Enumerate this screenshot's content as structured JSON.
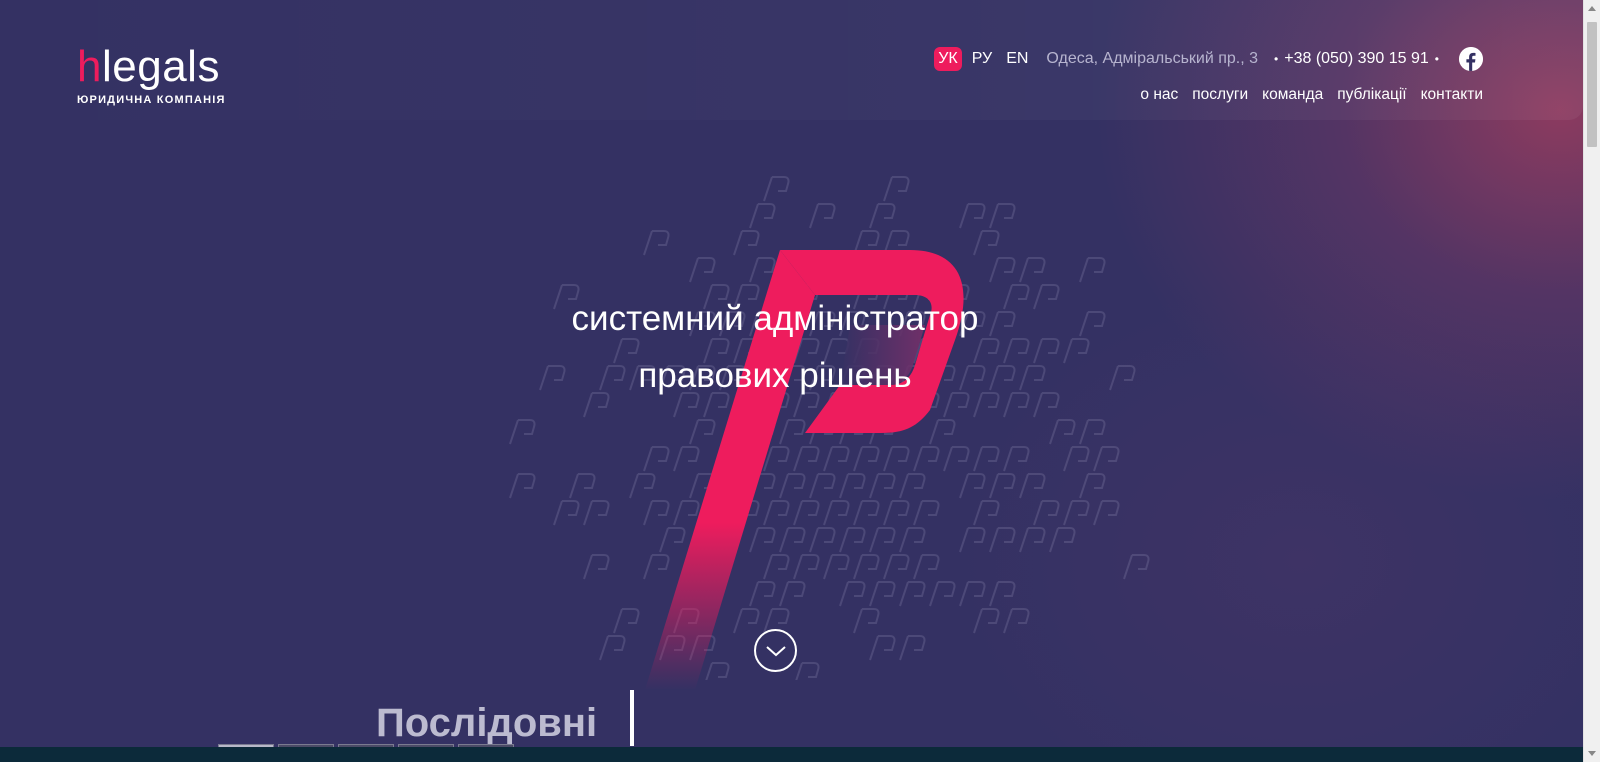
{
  "header": {
    "logo_prefix": "h",
    "logo_rest": "legals",
    "logo_subtitle": "ЮРИДИЧНА КОМПАНІЯ",
    "languages": [
      {
        "label": "УК",
        "active": true
      },
      {
        "label": "РУ",
        "active": false
      },
      {
        "label": "EN",
        "active": false
      }
    ],
    "address": "Одеса, Адміральський пр., 3",
    "phone": "+38 (050) 390 15 91",
    "separator": "•",
    "facebook_icon": "facebook-icon",
    "nav": [
      "о нас",
      "послуги",
      "команда",
      "публікації",
      "контакти"
    ]
  },
  "hero": {
    "title_line1": "системний адміністратор",
    "title_line2": "правових рішень",
    "scroll_icon": "chevron-down-icon"
  },
  "next_section": {
    "heading": "Послідовні"
  },
  "colors": {
    "background": "#343163",
    "accent": "#ee1c5d",
    "text": "#ffffff",
    "muted": "#b7b4cf"
  }
}
